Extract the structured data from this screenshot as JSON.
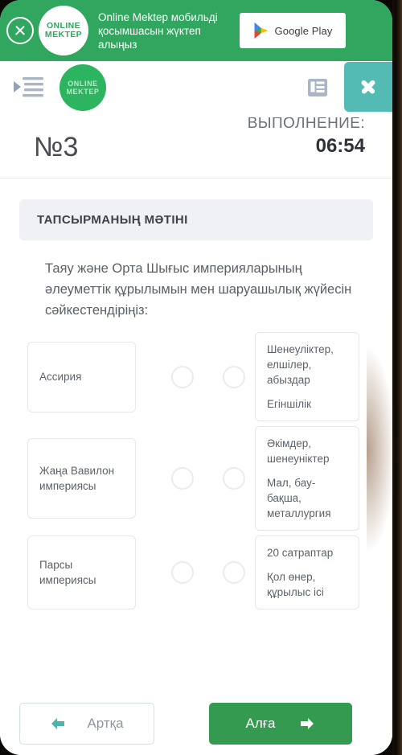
{
  "promo": {
    "close_icon": "close-circle-icon",
    "logo_line1": "ONLINE",
    "logo_line2": "MEKTEP",
    "text": "Online Mektep мобильді қосымшасын жүктеп алыңыз",
    "store_button": "Google Play",
    "store_icon": "google-play-icon",
    "bg_color": "#31a65f"
  },
  "appbar": {
    "menu_icon": "indent-list-icon",
    "logo_line1": "ONLINE",
    "logo_line2": "MEKTEP",
    "list_icon": "list-view-icon",
    "close_icon": "close-icon",
    "close_bg": "#53bab4"
  },
  "title_row": {
    "question_number": "№3",
    "timer_label": "ВЫПОЛНЕНИЕ:",
    "timer_value": "06:54"
  },
  "content": {
    "task_banner": "ТАПСЫРМАНЫҢ МӘТІНІ",
    "question": "Таяу және Орта Шығыс империяларының әлеуметтік құрылымын мен шаруашылық жүйесін сәйкестендіріңіз:",
    "pairs": [
      {
        "left": "Ассирия",
        "right_lines": [
          "Шенеуліктер, елшілер, абыздар",
          "Егіншілік"
        ],
        "left_selected": false,
        "right_selected": false
      },
      {
        "left": "Жаңа Вавилон империясы",
        "right_lines": [
          "Әкімдер, шенеуніктер",
          "Мал, бау-бақша, металлургия"
        ],
        "left_selected": false,
        "right_selected": false
      },
      {
        "left": "Парсы империясы",
        "right_lines": [
          "20 сатраптар",
          "Қол өнер, құрылыс ісі"
        ],
        "left_selected": false,
        "right_selected": false
      }
    ]
  },
  "footer": {
    "back_label": "Артқа",
    "back_icon": "arrow-left-icon",
    "next_label": "Алға",
    "next_icon": "arrow-right-icon",
    "next_color": "#349a50"
  }
}
